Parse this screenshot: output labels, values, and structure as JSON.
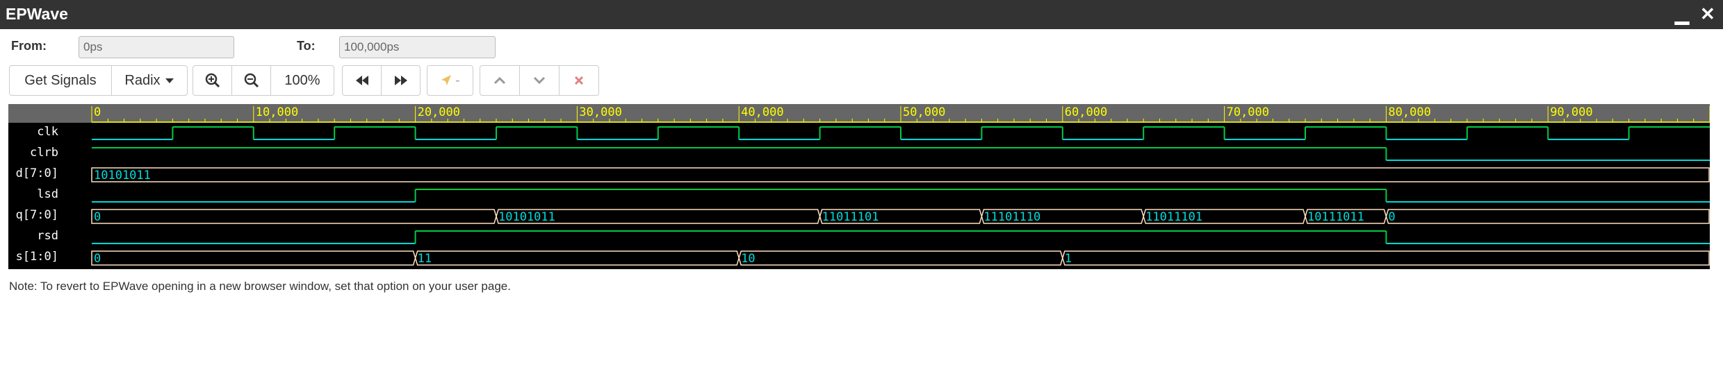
{
  "window": {
    "title": "EPWave",
    "minimize": "▁",
    "close": "✕"
  },
  "range": {
    "from_label": "From:",
    "from_value": "0ps",
    "to_label": "To:",
    "to_value": "100,000ps"
  },
  "toolbar": {
    "get_signals": "Get Signals",
    "radix": "Radix",
    "zoom_level": "100%",
    "cursor_label": "-",
    "colors": {
      "accent": "#337ab7",
      "cursor_disabled": "#f0c060",
      "delete": "#d9534f"
    }
  },
  "waveform": {
    "time_range_ps": [
      0,
      100000
    ],
    "colors": {
      "background": "#000000",
      "ruler_bg": "#666666",
      "ruler_text": "#ffff00",
      "signal_name": "#ffffff",
      "low": "#00d8d8",
      "high": "#00cc44",
      "bus_text": "#00dddd",
      "bus_outline": "#ffe0c0"
    },
    "ruler_labels": [
      {
        "t": 0,
        "label": "0"
      },
      {
        "t": 10000,
        "label": "10,000"
      },
      {
        "t": 20000,
        "label": "20,000"
      },
      {
        "t": 30000,
        "label": "30,000"
      },
      {
        "t": 40000,
        "label": "40,000"
      },
      {
        "t": 50000,
        "label": "50,000"
      },
      {
        "t": 60000,
        "label": "60,000"
      },
      {
        "t": 70000,
        "label": "70,000"
      },
      {
        "t": 80000,
        "label": "80,000"
      },
      {
        "t": 90000,
        "label": "90,000"
      }
    ],
    "signals": [
      {
        "name": "clk",
        "kind": "bit",
        "initial": 0,
        "edges": [
          5000,
          10000,
          15000,
          20000,
          25000,
          30000,
          35000,
          40000,
          45000,
          50000,
          55000,
          60000,
          65000,
          70000,
          75000,
          80000,
          85000,
          90000,
          95000
        ]
      },
      {
        "name": "clrb",
        "kind": "bit",
        "initial": 1,
        "edges": [
          80000
        ]
      },
      {
        "name": "d[7:0]",
        "kind": "bus",
        "segments": [
          {
            "t": 0,
            "v": "10101011"
          }
        ]
      },
      {
        "name": "lsd",
        "kind": "bit",
        "initial": 0,
        "edges": [
          20000,
          80000
        ]
      },
      {
        "name": "q[7:0]",
        "kind": "bus",
        "segments": [
          {
            "t": 0,
            "v": "0"
          },
          {
            "t": 25000,
            "v": "10101011"
          },
          {
            "t": 45000,
            "v": "11011101"
          },
          {
            "t": 55000,
            "v": "11101110"
          },
          {
            "t": 65000,
            "v": "11011101"
          },
          {
            "t": 75000,
            "v": "10111011"
          },
          {
            "t": 80000,
            "v": "0"
          }
        ]
      },
      {
        "name": "rsd",
        "kind": "bit",
        "initial": 0,
        "edges": [
          20000,
          80000
        ]
      },
      {
        "name": "s[1:0]",
        "kind": "bus",
        "segments": [
          {
            "t": 0,
            "v": "0"
          },
          {
            "t": 20000,
            "v": "11"
          },
          {
            "t": 40000,
            "v": "10"
          },
          {
            "t": 60000,
            "v": "1"
          }
        ]
      }
    ]
  },
  "note": "Note: To revert to EPWave opening in a new browser window, set that option on your user page."
}
